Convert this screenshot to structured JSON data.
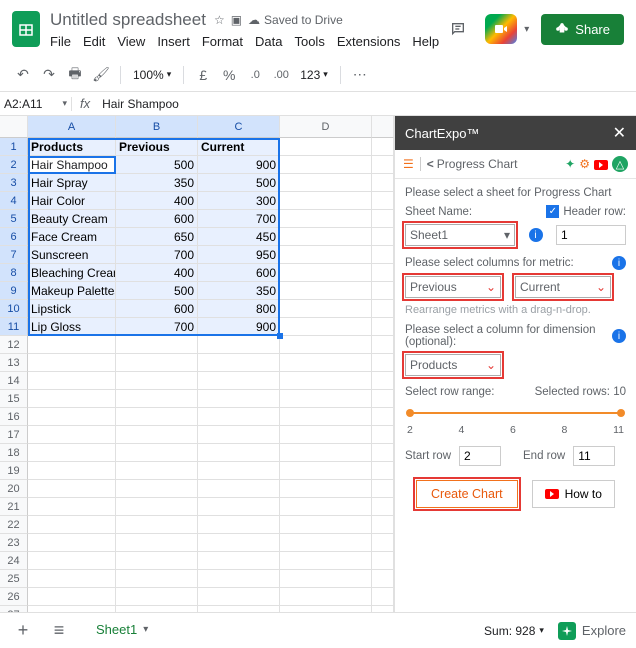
{
  "header": {
    "doc_title": "Untitled spreadsheet",
    "saved_label": "Saved to Drive",
    "share_label": "Share"
  },
  "menu": [
    "File",
    "Edit",
    "View",
    "Insert",
    "Format",
    "Data",
    "Tools",
    "Extensions",
    "Help"
  ],
  "toolbar": {
    "zoom": "100%",
    "currency1": "£",
    "currency2": "%",
    "dec1": ".0",
    "dec2": ".00",
    "fmt": "123"
  },
  "formula": {
    "cell_ref": "A2:A11",
    "value": "Hair Shampoo"
  },
  "columns": [
    "A",
    "B",
    "C",
    "D"
  ],
  "table": {
    "header": [
      "Products",
      "Previous",
      "Current"
    ],
    "rows": [
      [
        "Hair Shampoo",
        "500",
        "900"
      ],
      [
        "Hair Spray",
        "350",
        "500"
      ],
      [
        "Hair Color",
        "400",
        "300"
      ],
      [
        "Beauty Cream",
        "600",
        "700"
      ],
      [
        "Face Cream",
        "650",
        "450"
      ],
      [
        "Sunscreen",
        "700",
        "950"
      ],
      [
        "Bleaching Cream",
        "400",
        "600"
      ],
      [
        "Makeup Palettes",
        "500",
        "350"
      ],
      [
        "Lipstick",
        "600",
        "800"
      ],
      [
        "Lip Gloss",
        "700",
        "900"
      ]
    ],
    "total_rows": 27
  },
  "panel": {
    "title": "ChartExpo™",
    "sub_title": "Progress Chart",
    "intro": "Please select a sheet for Progress Chart",
    "sheet_label": "Sheet Name:",
    "header_row_label": "Header row:",
    "sheet_value": "Sheet1",
    "header_row_value": "1",
    "metric_label": "Please select columns for metric:",
    "metric1": "Previous",
    "metric2": "Current",
    "rearrange_hint": "Rearrange metrics with a drag-n-drop.",
    "dimension_label": "Please select a column for dimension (optional):",
    "dimension_value": "Products",
    "rowrange_label": "Select row range:",
    "selected_rows": "Selected rows: 10",
    "ticks": [
      "2",
      "4",
      "6",
      "8",
      "11"
    ],
    "start_row_label": "Start row",
    "start_row_value": "2",
    "end_row_label": "End row",
    "end_row_value": "11",
    "create_label": "Create Chart",
    "howto_label": "How to"
  },
  "bottom": {
    "sheet_tab": "Sheet1",
    "sum": "Sum: 928",
    "explore": "Explore"
  },
  "chart_data": {
    "type": "bar",
    "title": "Progress Chart",
    "categories": [
      "Hair Shampoo",
      "Hair Spray",
      "Hair Color",
      "Beauty Cream",
      "Face Cream",
      "Sunscreen",
      "Bleaching Cream",
      "Makeup Palettes",
      "Lipstick",
      "Lip Gloss"
    ],
    "series": [
      {
        "name": "Previous",
        "values": [
          500,
          350,
          400,
          600,
          650,
          700,
          400,
          500,
          600,
          700
        ]
      },
      {
        "name": "Current",
        "values": [
          900,
          500,
          300,
          700,
          450,
          950,
          600,
          350,
          800,
          900
        ]
      }
    ],
    "xlabel": "Products",
    "ylabel": "",
    "ylim": [
      0,
      1000
    ]
  }
}
